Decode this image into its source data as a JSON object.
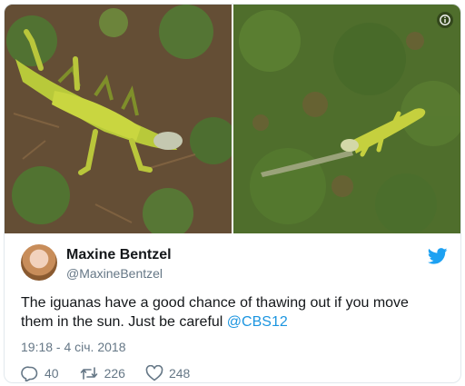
{
  "tweet": {
    "author_name": "Maxine Bentzel",
    "author_handle": "@MaxineBentzel",
    "text_line1": "The iguanas have a good chance of thawing out if you move",
    "text_line2": "them in the sun. Just be careful ",
    "mention": "@CBS12",
    "timestamp": "19:18 - 4 січ. 2018",
    "stats": {
      "replies": "40",
      "retweets": "226",
      "likes": "248"
    }
  },
  "icons": {
    "brand": "twitter-bird-icon",
    "info": "info-icon",
    "reply": "reply-icon",
    "retweet": "retweet-icon",
    "like": "heart-icon"
  },
  "colors": {
    "brand_blue": "#1da1f2",
    "link": "#1b95e0",
    "muted": "#657786",
    "text": "#14171a"
  }
}
